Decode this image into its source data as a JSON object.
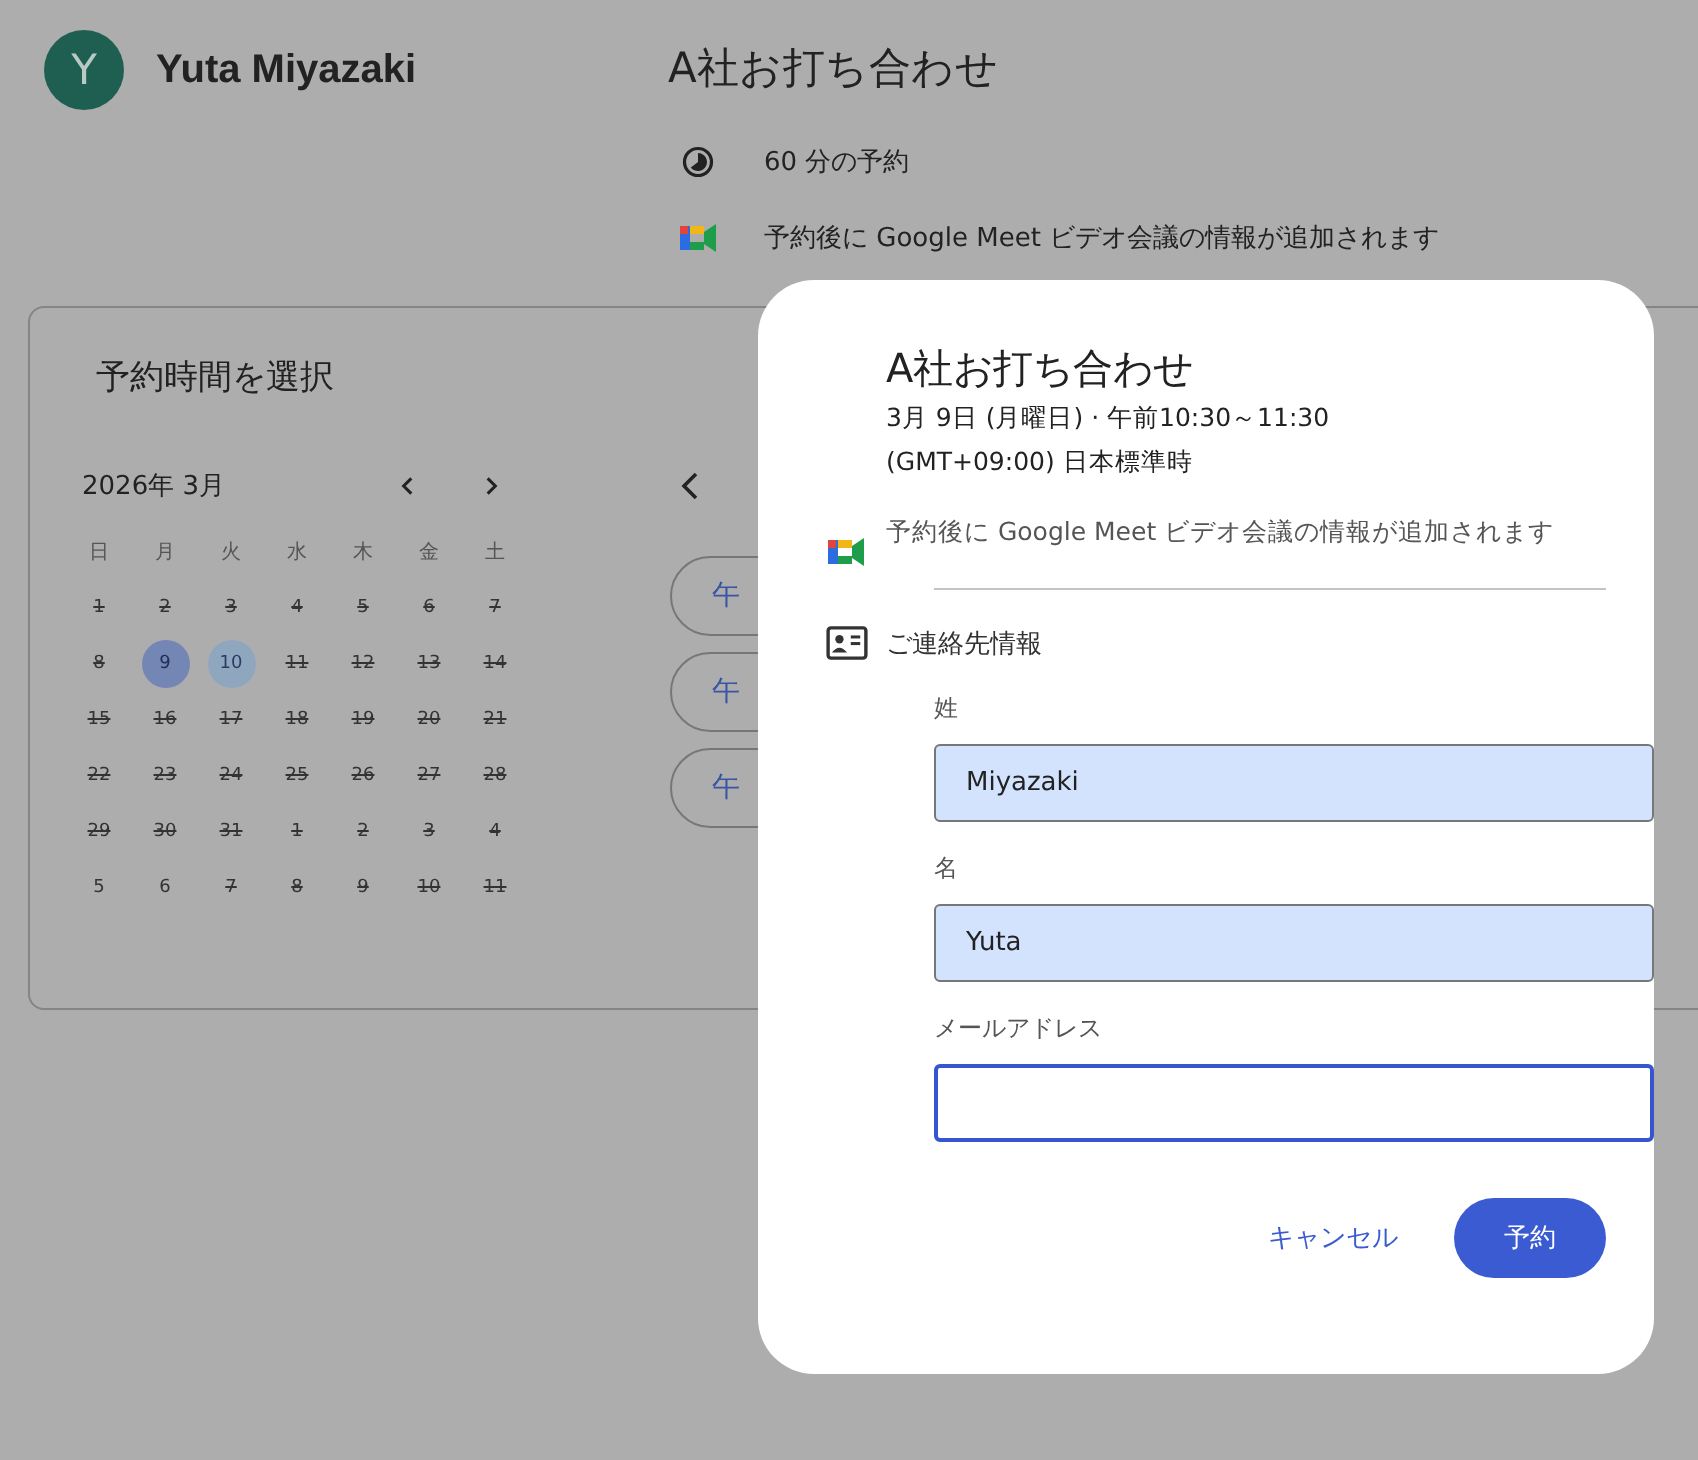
{
  "host": {
    "avatar_letter": "Y",
    "name": "Yuta Miyazaki"
  },
  "event": {
    "title": "A社お打ち合わせ",
    "duration": "60 分の予約",
    "meet_note": "予約後に Google Meet ビデオ会議の情報が追加されます"
  },
  "picker": {
    "heading": "予約時間を選択",
    "month": "2026年 3月",
    "weekdays": [
      "日",
      "月",
      "火",
      "水",
      "木",
      "金",
      "土"
    ],
    "days": [
      {
        "label": "1",
        "struck": true,
        "available": false,
        "selected": false
      },
      {
        "label": "2",
        "struck": true,
        "available": false,
        "selected": false
      },
      {
        "label": "3",
        "struck": true,
        "available": false,
        "selected": false
      },
      {
        "label": "4",
        "struck": true,
        "available": false,
        "selected": false
      },
      {
        "label": "5",
        "struck": true,
        "available": false,
        "selected": false
      },
      {
        "label": "6",
        "struck": true,
        "available": false,
        "selected": false
      },
      {
        "label": "7",
        "struck": true,
        "available": false,
        "selected": false
      },
      {
        "label": "8",
        "struck": true,
        "available": false,
        "selected": false
      },
      {
        "label": "9",
        "struck": false,
        "available": true,
        "selected": true
      },
      {
        "label": "10",
        "struck": false,
        "available": true,
        "selected": false
      },
      {
        "label": "11",
        "struck": true,
        "available": false,
        "selected": false
      },
      {
        "label": "12",
        "struck": true,
        "available": false,
        "selected": false
      },
      {
        "label": "13",
        "struck": true,
        "available": false,
        "selected": false
      },
      {
        "label": "14",
        "struck": true,
        "available": false,
        "selected": false
      },
      {
        "label": "15",
        "struck": true,
        "available": false,
        "selected": false
      },
      {
        "label": "16",
        "struck": true,
        "available": false,
        "selected": false
      },
      {
        "label": "17",
        "struck": true,
        "available": false,
        "selected": false
      },
      {
        "label": "18",
        "struck": true,
        "available": false,
        "selected": false
      },
      {
        "label": "19",
        "struck": true,
        "available": false,
        "selected": false
      },
      {
        "label": "20",
        "struck": true,
        "available": false,
        "selected": false
      },
      {
        "label": "21",
        "struck": true,
        "available": false,
        "selected": false
      },
      {
        "label": "22",
        "struck": true,
        "available": false,
        "selected": false
      },
      {
        "label": "23",
        "struck": true,
        "available": false,
        "selected": false
      },
      {
        "label": "24",
        "struck": true,
        "available": false,
        "selected": false
      },
      {
        "label": "25",
        "struck": true,
        "available": false,
        "selected": false
      },
      {
        "label": "26",
        "struck": true,
        "available": false,
        "selected": false
      },
      {
        "label": "27",
        "struck": true,
        "available": false,
        "selected": false
      },
      {
        "label": "28",
        "struck": true,
        "available": false,
        "selected": false
      },
      {
        "label": "29",
        "struck": true,
        "available": false,
        "selected": false
      },
      {
        "label": "30",
        "struck": true,
        "available": false,
        "selected": false
      },
      {
        "label": "31",
        "struck": true,
        "available": false,
        "selected": false
      },
      {
        "label": "1",
        "struck": true,
        "available": false,
        "selected": false
      },
      {
        "label": "2",
        "struck": true,
        "available": false,
        "selected": false
      },
      {
        "label": "3",
        "struck": true,
        "available": false,
        "selected": false
      },
      {
        "label": "4",
        "struck": true,
        "available": false,
        "selected": false
      },
      {
        "label": "5",
        "struck": false,
        "available": false,
        "selected": false
      },
      {
        "label": "6",
        "struck": false,
        "available": false,
        "selected": false
      },
      {
        "label": "7",
        "struck": true,
        "available": false,
        "selected": false
      },
      {
        "label": "8",
        "struck": true,
        "available": false,
        "selected": false
      },
      {
        "label": "9",
        "struck": true,
        "available": false,
        "selected": false
      },
      {
        "label": "10",
        "struck": true,
        "available": false,
        "selected": false
      },
      {
        "label": "11",
        "struck": true,
        "available": false,
        "selected": false
      }
    ],
    "time_slots": [
      "午",
      "午",
      "午"
    ]
  },
  "dialog": {
    "title": "A社お打ち合わせ",
    "when": "3月 9日 (月曜日) · 午前10:30～11:30",
    "timezone": "(GMT+09:00) 日本標準時",
    "meet_note": "予約後に Google Meet ビデオ会議の情報が追加されます",
    "contact_heading": "ご連絡先情報",
    "fields": [
      {
        "label": "姓",
        "value": "Miyazaki",
        "focused": false
      },
      {
        "label": "名",
        "value": "Yuta",
        "focused": false
      },
      {
        "label": "メールアドレス",
        "focused": true
      }
    ],
    "buttons": {
      "cancel": "キャンセル",
      "submit": "予約"
    }
  }
}
